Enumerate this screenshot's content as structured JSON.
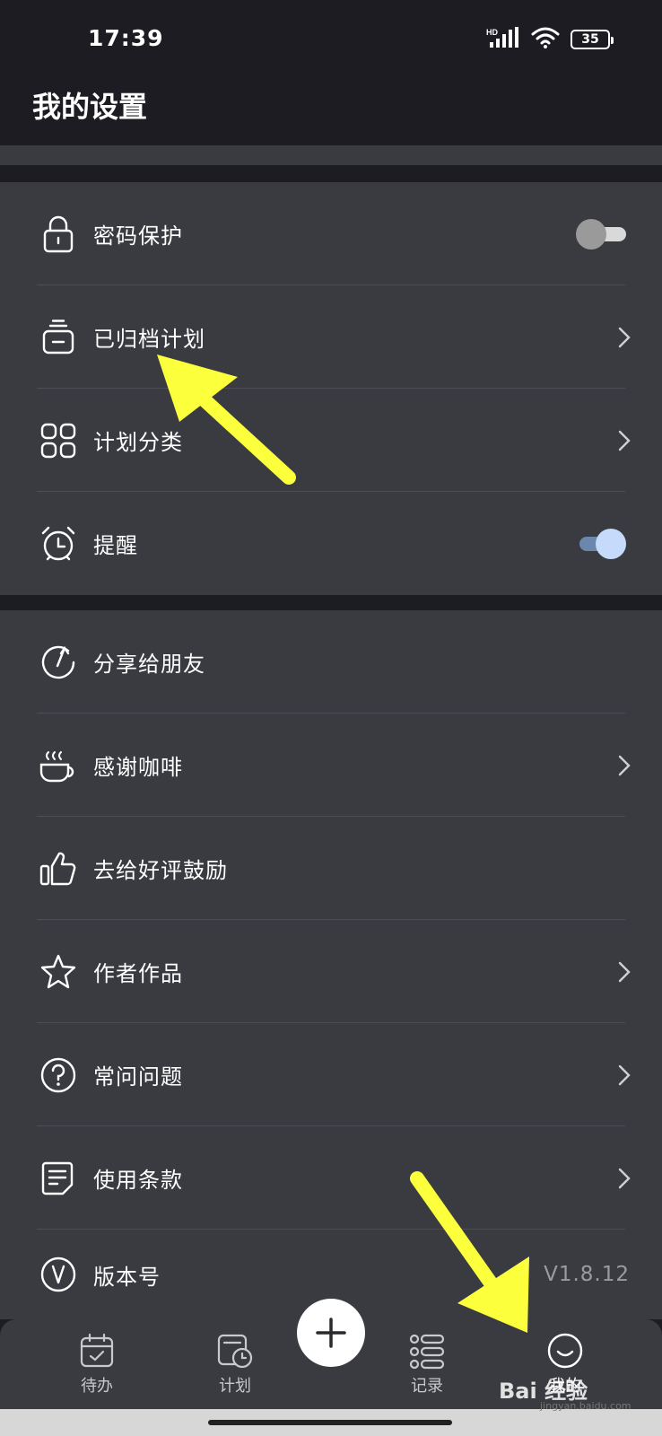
{
  "status_bar": {
    "time": "17:39",
    "network": "HD",
    "battery": "35"
  },
  "header": {
    "title": "我的设置"
  },
  "section1": {
    "items": [
      {
        "label": "密码保护",
        "icon": "lock-icon",
        "control": "toggle",
        "on": false
      },
      {
        "label": "已归档计划",
        "icon": "archive-icon",
        "control": "chevron"
      },
      {
        "label": "计划分类",
        "icon": "grid-icon",
        "control": "chevron"
      },
      {
        "label": "提醒",
        "icon": "alarm-clock-icon",
        "control": "toggle",
        "on": true
      }
    ]
  },
  "section2": {
    "items": [
      {
        "label": "分享给朋友",
        "icon": "share-icon",
        "control": "none"
      },
      {
        "label": "感谢咖啡",
        "icon": "coffee-icon",
        "control": "chevron"
      },
      {
        "label": "去给好评鼓励",
        "icon": "thumbs-up-icon",
        "control": "none"
      },
      {
        "label": "作者作品",
        "icon": "star-icon",
        "control": "chevron"
      },
      {
        "label": "常问问题",
        "icon": "question-icon",
        "control": "chevron"
      },
      {
        "label": "使用条款",
        "icon": "document-icon",
        "control": "chevron"
      },
      {
        "label": "版本号",
        "icon": "version-icon",
        "control": "text",
        "value": "V1.8.12"
      }
    ]
  },
  "tabbar": {
    "tabs": [
      {
        "label": "待办",
        "icon": "calendar-check-icon"
      },
      {
        "label": "计划",
        "icon": "plan-clock-icon"
      },
      {
        "label": "记录",
        "icon": "record-list-icon"
      },
      {
        "label": "我的",
        "icon": "smile-face-icon"
      }
    ],
    "fab_icon": "plus-icon"
  },
  "watermark": {
    "text": "Bai 经验",
    "url": "jingyan.baidu.com"
  },
  "colors": {
    "background": "#1c1c22",
    "card": "#3a3b41",
    "toggle_on_knob": "#c6dbfb",
    "toggle_on_track": "#6b87ad",
    "toggle_off_knob": "#9a9a9a",
    "toggle_off_track": "#d9d9d9",
    "annotation_arrow": "#fbff3c"
  }
}
